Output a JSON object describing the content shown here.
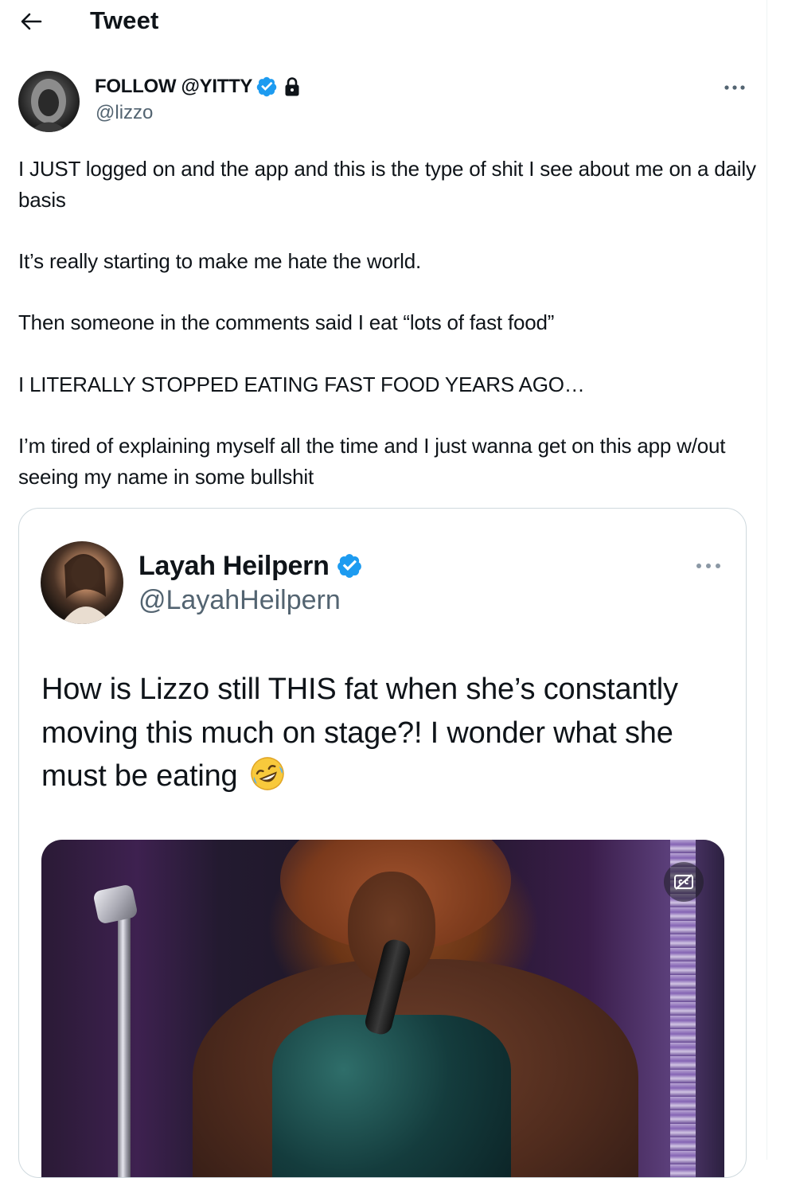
{
  "header": {
    "title": "Tweet"
  },
  "tweet": {
    "author_name": "FOLLOW @YITTY",
    "author_handle": "@lizzo",
    "paragraphs": [
      "I JUST logged on and the app and this is the type of shit I see about me on a daily basis",
      "It’s really starting to make me hate the world.",
      "Then someone in the comments said I eat “lots of fast food”",
      "I LITERALLY STOPPED EATING FAST FOOD YEARS AGO…",
      "I’m tired of explaining myself all the time and I just wanna get on this app w/out seeing my name in some bullshit"
    ]
  },
  "quoted_tweet": {
    "author_name": "Layah Heilpern",
    "author_handle": "@LayahHeilpern",
    "text": "How is Lizzo still THIS fat when she’s constantly moving this much on stage?! I wonder what she must be eating"
  },
  "colors": {
    "text": "#0f1419",
    "secondary": "#536471",
    "verified_blue": "#1d9bf0",
    "border": "#cfd9de"
  },
  "icons": {
    "back": "arrow-left-icon",
    "verified": "verified-badge-icon",
    "lock": "lock-icon",
    "more": "more-horizontal-icon",
    "emoji": "rolling-on-floor-laughing-emoji",
    "captions": "captions-off-icon"
  }
}
